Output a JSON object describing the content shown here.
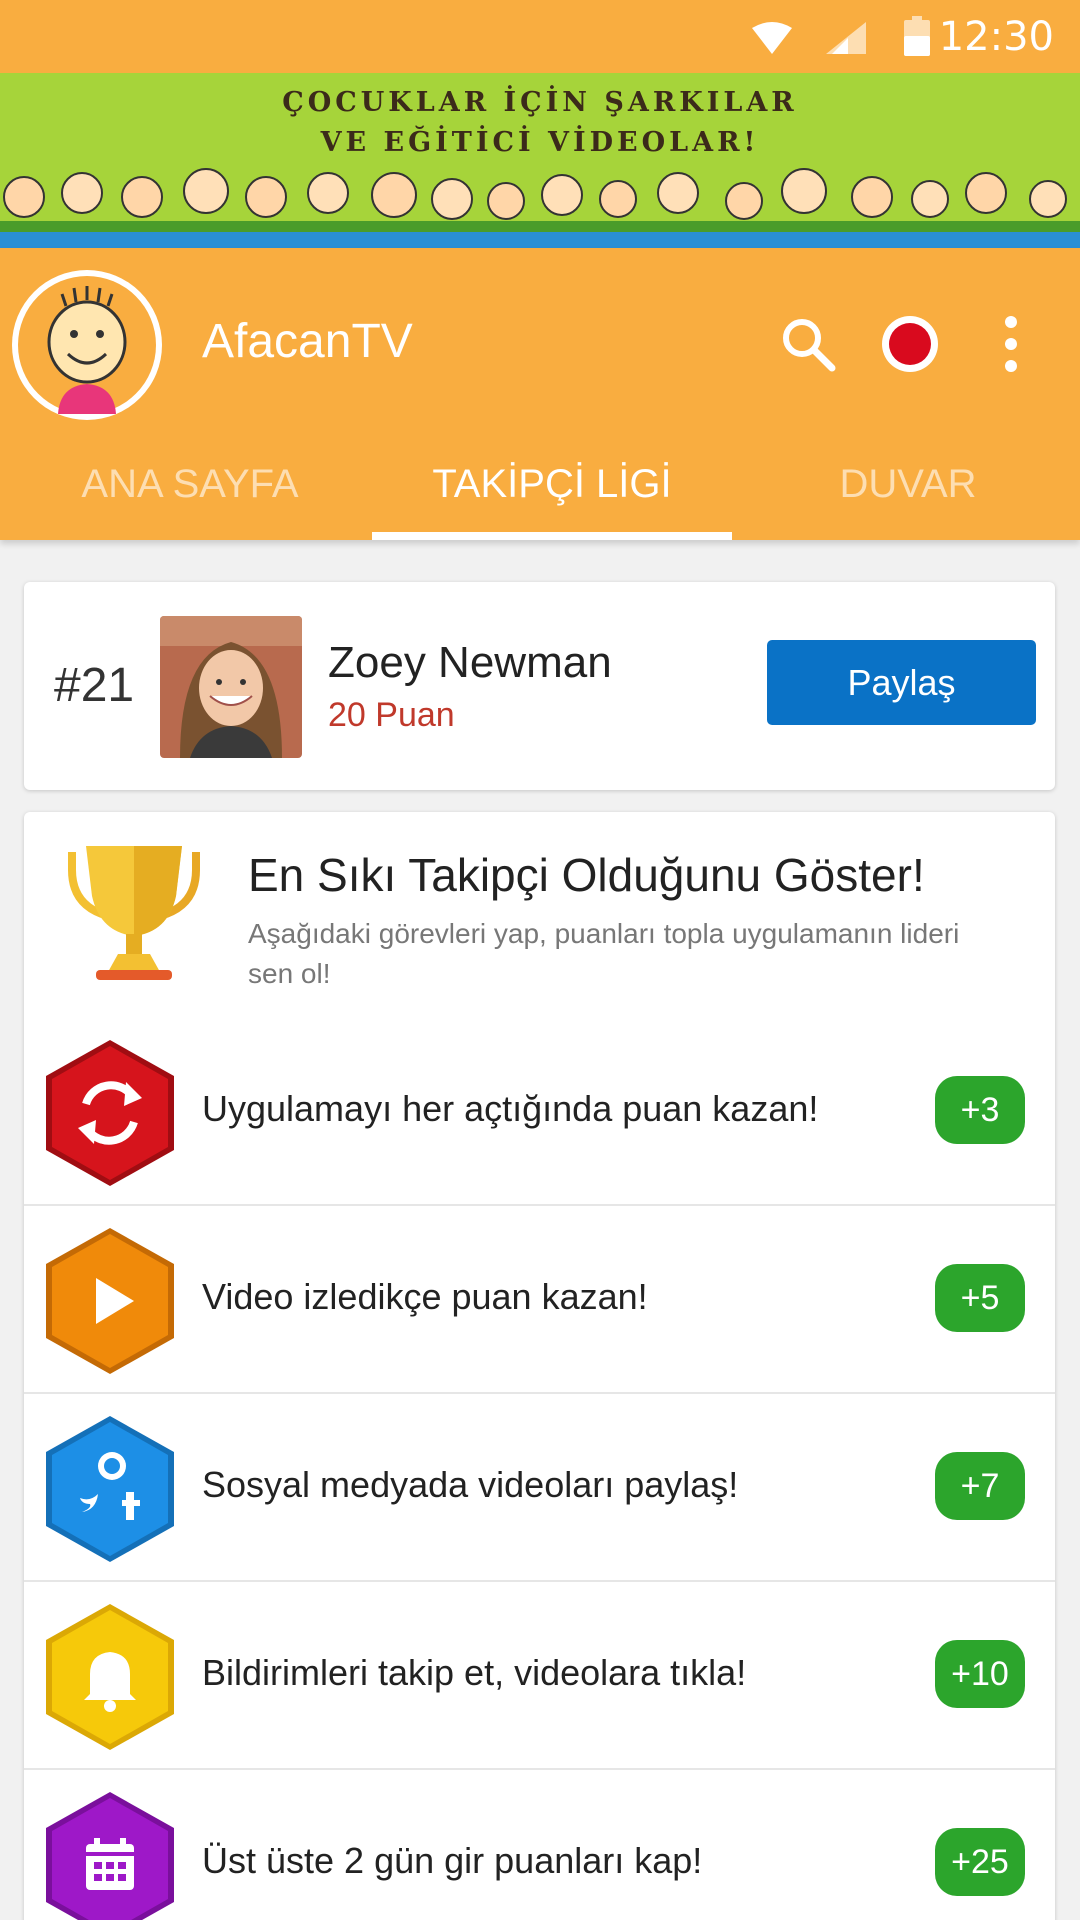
{
  "status_bar": {
    "time": "12:30",
    "icons": [
      "wifi-icon",
      "signal-icon",
      "battery-icon"
    ]
  },
  "banner": {
    "line1": "ÇOCUKLAR İÇİN ŞARKILAR",
    "line2": "VE EĞİTİCİ VİDEOLAR!"
  },
  "header": {
    "title": "AfacanTV",
    "icons": [
      "search-icon",
      "record-icon",
      "more-vert-icon"
    ],
    "tabs": [
      {
        "label": "ANA SAYFA",
        "active": false
      },
      {
        "label": "TAKİPÇİ LİGİ",
        "active": true
      },
      {
        "label": "DUVAR",
        "active": false
      }
    ]
  },
  "profile": {
    "rank": "#21",
    "name": "Zoey Newman",
    "points": "20 Puan",
    "share_label": "Paylaş"
  },
  "tasks": {
    "title": "En Sıkı Takipçi Olduğunu Göster!",
    "description": "Aşağıdaki görevleri yap, puanları topla uygulamanın lideri sen ol!",
    "items": [
      {
        "icon": "refresh-icon",
        "color": "#d6141c",
        "label": "Uygulamayı her açtığında puan kazan!",
        "points": "+3"
      },
      {
        "icon": "play-icon",
        "color": "#f08a0a",
        "label": "Video izledikçe puan kazan!",
        "points": "+5"
      },
      {
        "icon": "social-share-icon",
        "color": "#1d8fe6",
        "label": "Sosyal medyada videoları paylaş!",
        "points": "+7"
      },
      {
        "icon": "bell-icon",
        "color": "#f6c90a",
        "label": "Bildirimleri takip et, videolara tıkla!",
        "points": "+10"
      },
      {
        "icon": "calendar-icon",
        "color": "#9e18c8",
        "label": "Üst üste 2 gün gir puanları kap!",
        "points": "+25"
      }
    ]
  },
  "colors": {
    "primary": "#f9ad40",
    "share_button": "#0a72c6",
    "badge": "#2ca52c",
    "points_text": "#c0392b"
  }
}
